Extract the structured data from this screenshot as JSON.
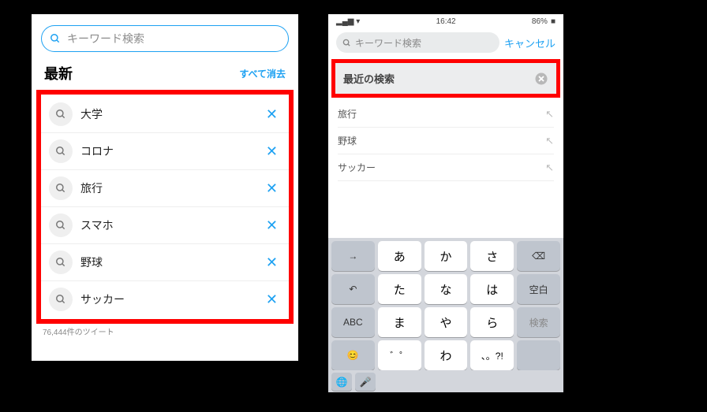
{
  "left": {
    "search_placeholder": "キーワード検索",
    "recent_title": "最新",
    "clear_all": "すべて消去",
    "items": [
      "大学",
      "コロナ",
      "旅行",
      "スマホ",
      "野球",
      "サッカー"
    ],
    "truncated_text": "76,444件のツイート"
  },
  "right": {
    "status_time": "16:42",
    "status_battery": "86%",
    "search_placeholder": "キーワード検索",
    "cancel": "キャンセル",
    "recent_header": "最近の検索",
    "items": [
      "旅行",
      "野球",
      "サッカー"
    ],
    "keyboard": {
      "rows": [
        [
          "→",
          "あ",
          "か",
          "さ",
          "⌫"
        ],
        [
          "↶",
          "た",
          "な",
          "は",
          "空白"
        ],
        [
          "ABC",
          "ま",
          "や",
          "ら",
          "検索"
        ],
        [
          "😊",
          "゛゜",
          "わ",
          "、。?!",
          ""
        ]
      ],
      "bottom": [
        "🌐",
        "🎤"
      ]
    }
  }
}
